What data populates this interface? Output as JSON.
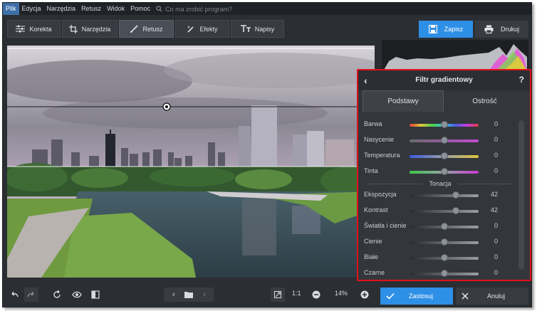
{
  "menu": {
    "items": [
      "Plik",
      "Edycja",
      "Narzędzia",
      "Retusz",
      "Widok",
      "Pomoc"
    ],
    "search_placeholder": "Co ma zrobić program?"
  },
  "tabs": [
    {
      "label": "Korekta",
      "icon": "sliders-icon"
    },
    {
      "label": "Narzędzia",
      "icon": "crop-icon"
    },
    {
      "label": "Retusz",
      "icon": "brush-icon"
    },
    {
      "label": "Efekty",
      "icon": "magic-wand-icon"
    },
    {
      "label": "Napisy",
      "icon": "text-icon"
    }
  ],
  "toolbar": {
    "save_label": "Zapisz",
    "print_label": "Drukuj"
  },
  "panel": {
    "title": "Filtr gradientowy",
    "back_icon": "chevron-left-icon",
    "help_label": "?",
    "tab_basic": "Podstawy",
    "tab_sharpness": "Ostrość",
    "section_tone": "Tonacja",
    "color_sliders": [
      {
        "label": "Barwa",
        "value": "0",
        "level": 0.5
      },
      {
        "label": "Nasycenie",
        "value": "0",
        "level": 0.5
      },
      {
        "label": "Temperatura",
        "value": "0",
        "level": 0.5
      },
      {
        "label": "Tinta",
        "value": "0",
        "level": 0.5
      }
    ],
    "tone_sliders": [
      {
        "label": "Ekspozycja",
        "value": "42",
        "level": 0.67
      },
      {
        "label": "Kontrast",
        "value": "42",
        "level": 0.67
      },
      {
        "label": "Światła i cienie",
        "value": "0",
        "level": 0.5
      },
      {
        "label": "Cienie",
        "value": "0",
        "level": 0.5
      },
      {
        "label": "Białe",
        "value": "0",
        "level": 0.5
      },
      {
        "label": "Czarne",
        "value": "0",
        "level": 0.5
      }
    ]
  },
  "bottom": {
    "zoom_ratio_label": "1:1",
    "zoom_percent": "14%",
    "apply_label": "Zastosuj",
    "cancel_label": "Anuluj"
  },
  "colors": {
    "accent": "#2e8fe6",
    "highlight_border": "#e2101a"
  }
}
